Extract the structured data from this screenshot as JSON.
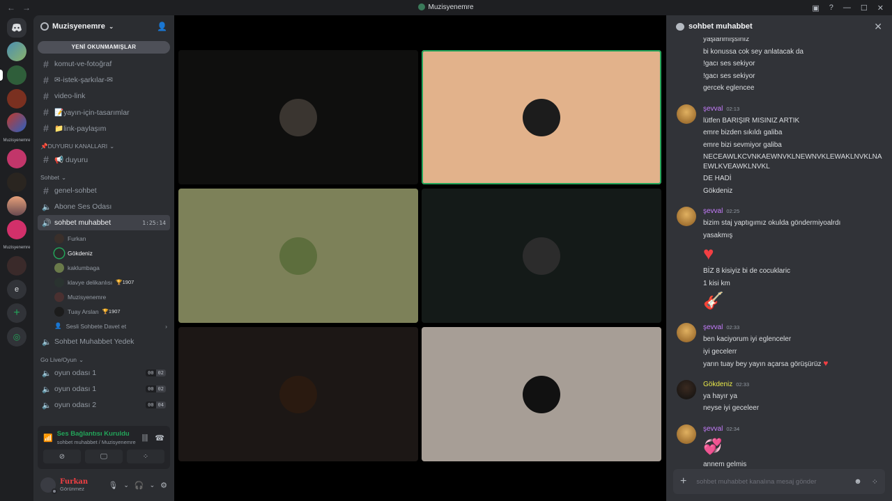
{
  "window": {
    "title": "Muzisyenemre"
  },
  "rail": {
    "text_label_1": "Muzisyenemre",
    "text_label_2": "Muzisyenemre",
    "letter_server": "e"
  },
  "server": {
    "name": "Muzisyenemre"
  },
  "sidebar": {
    "unread_label": "YENİ OKUNMAMIŞLAR",
    "top_channels": [
      {
        "name": "komut-ve-fotoğraf"
      },
      {
        "name": "✉-istek-şarkılar-✉"
      },
      {
        "name": "video-link"
      },
      {
        "name": "📝yayın-için-tasarımlar"
      },
      {
        "name": "📁link-paylaşım"
      }
    ],
    "cat_duyuru": "📌DUYURU KANALLARI",
    "duyuru_channel": "📢 duyuru",
    "cat_sohbet": "Sohbet",
    "sohbet_channels": {
      "genel": "genel-sohbet",
      "abone": "Abone Ses Odası",
      "active": "sohbet muhabbet",
      "active_timer": "1:25:14"
    },
    "voice_users": [
      {
        "name": "Furkan",
        "badge": ""
      },
      {
        "name": "Gökdeniz",
        "badge": ""
      },
      {
        "name": "kaklumbaga",
        "badge": ""
      },
      {
        "name": "klavye delikanlısı",
        "badge": "🏆1907"
      },
      {
        "name": "Muzisyenemre",
        "badge": ""
      },
      {
        "name": "Tuay Arslan",
        "badge": "🏆1907"
      }
    ],
    "invite_label": "Sesli Sohbete Davet et",
    "yedek_channel": "Sohbet Muhabbet Yedek",
    "cat_golive": "Go Live/Oyun",
    "game_rooms": [
      {
        "name": "oyun odası 1",
        "c1": "00",
        "c2": "02"
      },
      {
        "name": "oyun odası 1",
        "c1": "00",
        "c2": "02"
      },
      {
        "name": "oyun odası 2",
        "c1": "00",
        "c2": "04"
      }
    ]
  },
  "voice_panel": {
    "status": "Ses Bağlantısı Kuruldu",
    "location": "sohbet muhabbet / Muzisyenemre"
  },
  "user_panel": {
    "name": "Furkan",
    "status": "Görünmez"
  },
  "stage": {
    "tiles": [
      {
        "bg": "#0f0f0e",
        "speaking": false,
        "avatar": "#3a3530"
      },
      {
        "bg": "#e2b28b",
        "speaking": true,
        "avatar": "#1c1c1c"
      },
      {
        "bg": "#7d8159",
        "speaking": false,
        "avatar": "#5d6e3d"
      },
      {
        "bg": "#141a18",
        "speaking": false,
        "avatar": "#2c2c2c"
      },
      {
        "bg": "#1c1715",
        "speaking": false,
        "avatar": "#2a1a10"
      },
      {
        "bg": "#a79e96",
        "speaking": false,
        "avatar": "#111111"
      }
    ]
  },
  "chat": {
    "title": "sohbet muhabbet",
    "top_lines": [
      "yaşlanmışsınız",
      "bi konussa cok sey anlatacak da",
      "!gacı ses sekiyor",
      "!gacı ses sekiyor",
      "gercek eglencee"
    ],
    "groups": [
      {
        "author": "şevval",
        "color": "#c77dff",
        "time": "02:13",
        "lines": [
          "lütfen BARIŞIR MISINIZ ARTIK",
          "emre bizden sıkıldı galiba",
          "emre bizi sevmiyor galiba",
          "NECEAWLKCVNKAEWNVKLNEWNVKLEWAKLNVKLNAEWLKVEAWKLNVKL",
          "DE HADİ",
          "Gökdeniz"
        ]
      },
      {
        "author": "şevval",
        "color": "#c77dff",
        "time": "02:25",
        "lines": [
          "bizim staj yaptıgımız okulda göndermiyoalrdı",
          "yasakmış"
        ],
        "after_emoji": "heart",
        "lines2": [
          "BİZ 8 kisiyiz bi de cocuklaric",
          "1 kisi km"
        ],
        "after_emoji2": "guitar"
      },
      {
        "author": "şevval",
        "color": "#c77dff",
        "time": "02:33",
        "lines": [
          "ben kaciyorum iyi eglenceler",
          "iyi gecelerr",
          "yarın tuay bey yayın açarsa görüşürüz"
        ]
      },
      {
        "author": "Gökdeniz",
        "color": "#e8e84a",
        "time": "02:33",
        "lines": [
          "ya hayır ya",
          "neyse iyi geceleer"
        ]
      },
      {
        "author": "şevval",
        "color": "#c77dff",
        "time": "02:34",
        "lines": [
          "annem gelmis"
        ]
      }
    ],
    "composer_placeholder": "sohbet muhabbet kanalına mesaj gönder"
  }
}
